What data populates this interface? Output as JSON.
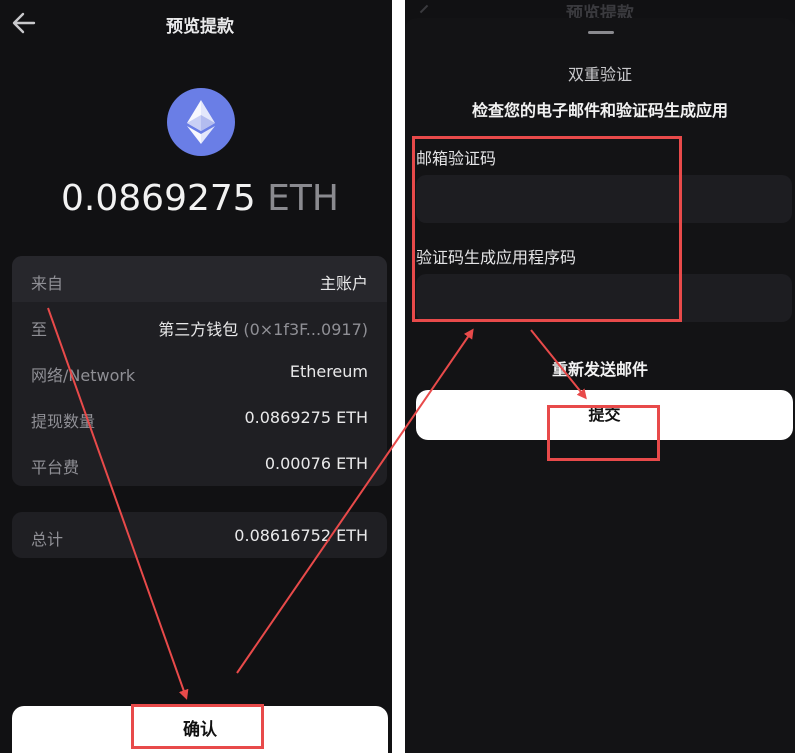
{
  "preview": {
    "title": "预览提款",
    "amount_value": "0.0869275",
    "amount_unit": "ETH",
    "rows": [
      {
        "label": "来自",
        "value": "主账户",
        "extra": ""
      },
      {
        "label": "至",
        "value": "第三方钱包",
        "extra": "(0×1f3F...0917)"
      },
      {
        "label": "网络/Network",
        "value": "Ethereum",
        "extra": ""
      },
      {
        "label": "提现数量",
        "value": "0.0869275 ETH",
        "extra": ""
      },
      {
        "label": "平台费",
        "value": "0.00076 ETH",
        "extra": ""
      }
    ],
    "total": {
      "label": "总计",
      "value": "0.08616752 ETH"
    },
    "confirm_label": "确认"
  },
  "verify": {
    "title": "双重验证",
    "subtitle": "检查您的电子邮件和验证码生成应用",
    "email_code_label": "邮箱验证码",
    "email_code_value": "",
    "auth_code_label": "验证码生成应用程序码",
    "auth_code_value": "",
    "resend_label": "重新发送邮件",
    "submit_label": "提交"
  },
  "icons": {
    "back": "arrow-left-icon",
    "eth": "ethereum-icon"
  },
  "colors": {
    "background": "#111113",
    "card": "#1f1f23",
    "eth_blue": "#6a7ee6",
    "annotation_red": "#e84a4a",
    "button": "#ffffff"
  }
}
